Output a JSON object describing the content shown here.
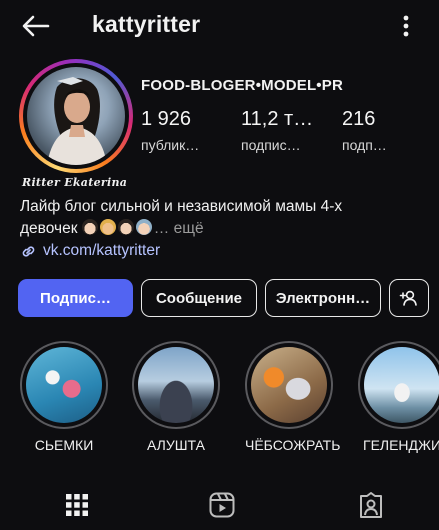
{
  "header": {
    "username": "kattyritter",
    "back_icon": "back-arrow-icon",
    "more_icon": "vertical-dots-icon"
  },
  "profile": {
    "signature": "Ritter Ekaterina",
    "category": "FOOD-BLOGER•MODEL•PR",
    "stats": [
      {
        "value": "1 926",
        "label": "публик…"
      },
      {
        "value": "11,2 т…",
        "label": "подпис…"
      },
      {
        "value": "216",
        "label": "подп…"
      }
    ],
    "bio_line1": "Лайф блог сильной и независимой мамы 4-х",
    "bio_line2": "девочек",
    "bio_more": "… ещё",
    "link": "vk.com/kattyritter"
  },
  "actions": {
    "follow": "Подпис…",
    "message": "Сообщение",
    "email": "Электронн…"
  },
  "highlights": [
    {
      "label": "СЬЕМКИ"
    },
    {
      "label": "АЛУШТА"
    },
    {
      "label": "ЧЁБСОЖРАТЬ"
    },
    {
      "label": "ГЕЛЕНДЖИ"
    }
  ],
  "tabs": [
    "grid-icon",
    "reels-icon",
    "tagged-icon"
  ],
  "colors": {
    "background": "#0d0d10",
    "accent_button": "#5264f2",
    "link": "#b6c3ff"
  }
}
